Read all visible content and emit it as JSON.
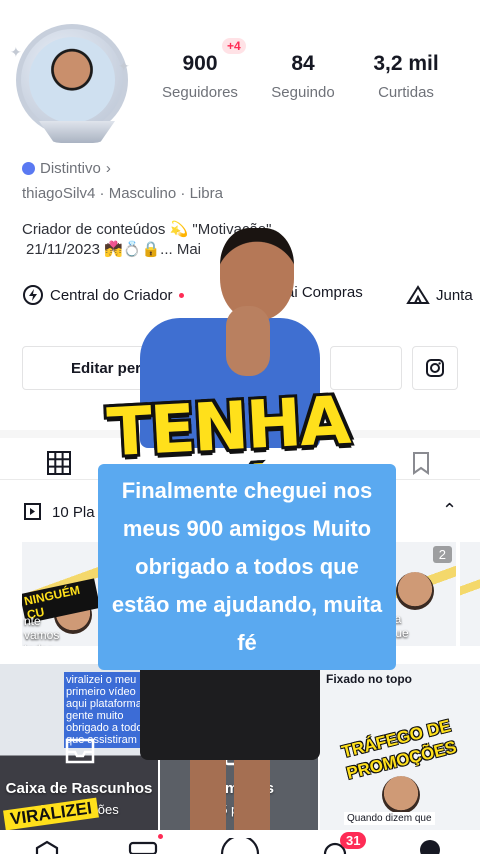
{
  "profile": {
    "stats": [
      {
        "value": "900",
        "label": "Seguidores"
      },
      {
        "value": "84",
        "label": "Seguindo"
      },
      {
        "value": "3,2 mil",
        "label": "Curtidas"
      }
    ],
    "followers_delta": "+4",
    "distintivo": "Distintivo",
    "meta": "thiagoSilv4 · Masculino · Libra",
    "bio_line1": "Criador de conteúdos 💫 \"Motivação\"",
    "bio_line2": "21/11/2023 💏💍🔒... Mai",
    "links": {
      "creator_center": "Central do Criador",
      "purchases": "ai Compras",
      "join": "Junta"
    },
    "edit_button": "Editar perfi"
  },
  "playlist": {
    "label": "10 Pla"
  },
  "thumb_texts": {
    "ninguem": "NINGUÉM CU",
    "vamos": "nte vamos todos",
    "volta": "volta segue",
    "count": "2"
  },
  "grid": {
    "drafts_title": "Caixa de Rascunhos",
    "drafts_sub": "2 publicações",
    "memories_title": "Memórias",
    "memories_sub": "15 public",
    "pinned_label": "Fixado no topo",
    "trafego": "TRÁFEGO DE PROMOÇÕES",
    "viralizou": "viralizei o meu primeiro vídeo aqui plataforma gente muito obrigado a todos que assistiram",
    "viral_stamp": "VIRALIZEI",
    "quando": "Quando dizem que"
  },
  "overlay": {
    "title": "TENHA FÉ",
    "caption": "Finalmente cheguei nos meus 900 amigos Muito obrigado a todos que estão me ajudando, muita fé"
  },
  "nav": {
    "inbox_badge": "31"
  }
}
